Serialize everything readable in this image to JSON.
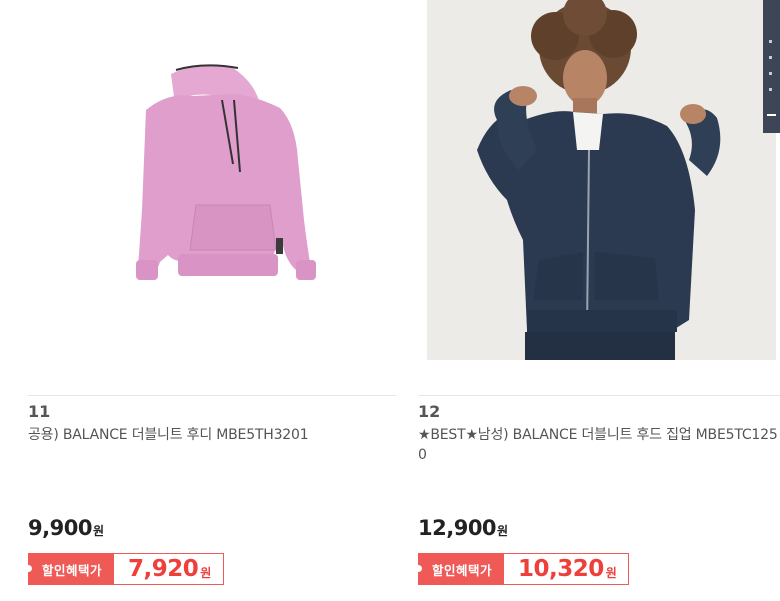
{
  "products": [
    {
      "rank": "11",
      "name": "공용) BALANCE 더블니트 후디 MBE5TH3201",
      "price": "9,900",
      "price_unit": "원",
      "deal_label": "할인혜택가",
      "deal_price": "7,920",
      "deal_unit": "원",
      "image": "pink-hoodie"
    },
    {
      "rank": "12",
      "name": "★BEST★남성) BALANCE 더블니트 후드 집업 MBE5TC1250",
      "price": "12,900",
      "price_unit": "원",
      "deal_label": "할인혜택가",
      "deal_price": "10,320",
      "deal_unit": "원",
      "image": "navy-zip-hoodie-model"
    }
  ],
  "colors": {
    "accent": "#ef5a57",
    "deal_text": "#ef3f3b",
    "hoodie_pink": "#df9ecb",
    "hoodie_navy": "#2b3a50",
    "side_widget": "#3c4657"
  }
}
